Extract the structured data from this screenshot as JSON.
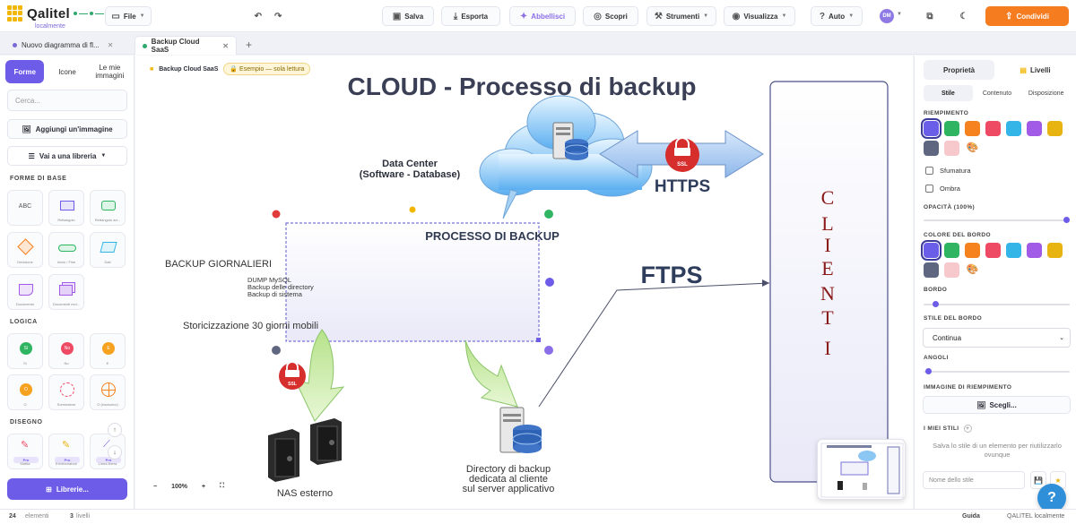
{
  "app": {
    "logo_text": "Qalitel",
    "logo_sub": "localmente"
  },
  "toolbar": {
    "file": "File",
    "save": "Salva",
    "export": "Esporta",
    "beautify": "Abbellisci",
    "discover": "Scopri",
    "tools": "Strumenti",
    "view": "Visualizza",
    "auto": "Auto",
    "avatar": "DM",
    "share": "Condividi"
  },
  "tabs": [
    {
      "label": "Nuovo diagramma di fl...",
      "dot": "#7a6ad8"
    },
    {
      "label": "Backup Cloud SaaS",
      "dot": "#2ea86b"
    }
  ],
  "left": {
    "tabs": [
      "Forme",
      "Icone",
      "Le mie immagini"
    ],
    "search_placeholder": "Cerca...",
    "add_image": "Aggiungi un'immagine",
    "library": "Vai a una libreria",
    "sec_basic": "FORME DI BASE",
    "sec_logic": "LOGICA",
    "sec_draw": "DISEGNO",
    "basic_shapes": [
      "ABC",
      "Rettangolo",
      "Rettangolo arr...",
      "Decisione",
      "Inizio / Fine",
      "Dati",
      "Documento",
      "Documenti mul..."
    ],
    "logic_shapes": [
      "Sì",
      "No",
      "E",
      "O",
      "Sommatore",
      "O (esclusivo)"
    ],
    "logic_marks": [
      "Sì",
      "No",
      "E",
      "O"
    ],
    "draw_shapes": [
      "Matita",
      "Evidenziatore",
      "Linea libera"
    ],
    "pro_label": "Pro",
    "libraries_btn": "Librerie..."
  },
  "canvas": {
    "breadcrumb": "Backup Cloud SaaS",
    "readonly_badge": "Esempio — sola lettura",
    "title": "CLOUD - Processo di backup",
    "datacenter_line1": "Data Center",
    "datacenter_line2": "(Software - Database)",
    "https": "HTTPS",
    "ftps": "FTPS",
    "ssl": "SSL",
    "process_title": "PROCESSO DI BACKUP",
    "daily_backups": "BACKUP GIORNALIERI",
    "dump_lines": [
      "DUMP MySQL",
      "Backup delle directory",
      "Backup di sistema"
    ],
    "history": "Storicizzazione 30 giorni mobili",
    "clients": [
      "C",
      "L",
      "I",
      "E",
      "N",
      "T",
      "I"
    ],
    "nas": "NAS esterno",
    "dir_lines": [
      "Directory di backup",
      "dedicata al cliente",
      "sul server applicativo"
    ],
    "zoom": "100%"
  },
  "right": {
    "tab_props": "Proprietà",
    "tab_layers": "Livelli",
    "sub_tabs": [
      "Stile",
      "Contenuto",
      "Disposizione"
    ],
    "fill_label": "RIEMPIMENTO",
    "gradient": "Sfumatura",
    "shadow": "Ombra",
    "opacity_label": "OPACITÀ (100%)",
    "opacity": 1.0,
    "border_color_label": "COLORE DEL BORDO",
    "border_label": "BORDO",
    "border_style_label": "STILE DEL BORDO",
    "border_style": "Continua",
    "corners_label": "ANGOLI",
    "fill_image_label": "IMMAGINE DI RIEMPIMENTO",
    "choose": "Scegli...",
    "my_styles_label": "I MIEI STILI",
    "my_styles_help": "Salva lo stile di un elemento per riutilizzarlo ovunque",
    "style_name_placeholder": "Nome dello stile",
    "colors": [
      "#6a5ee8",
      "#2fb562",
      "#f6821f",
      "#ef4a63",
      "#33b5e8",
      "#a25be6",
      "#e7b412",
      "#5f6780",
      "#f8c9cc"
    ]
  },
  "status": {
    "elements_count": "24",
    "elements_label": "elementi",
    "layers_count": "3",
    "layers_label": "livelli",
    "guide": "Guida",
    "brand": "QALITEL localmente"
  }
}
